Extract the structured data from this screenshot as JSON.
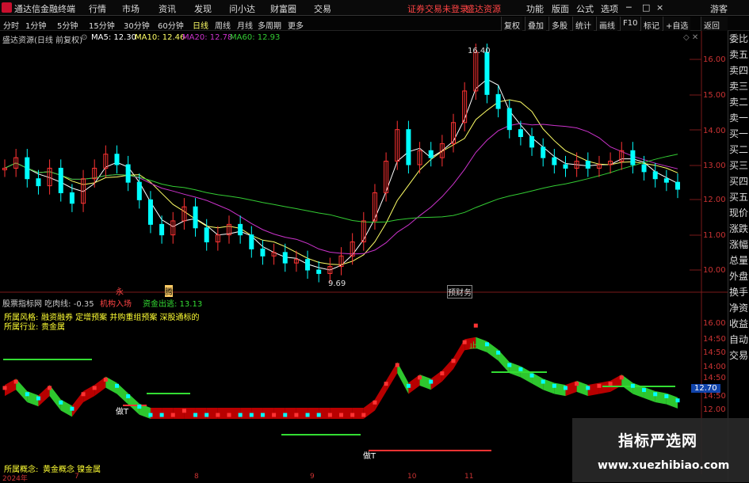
{
  "title_bar": {
    "app_name": "通达信金融终端",
    "menu": [
      "行情",
      "市场",
      "资讯",
      "发现",
      "问小达",
      "财富圈",
      "交易"
    ],
    "login_notice": "证券交易未登录",
    "source": "盛达资源",
    "right_menu": [
      "功能",
      "版面",
      "公式",
      "选项"
    ],
    "user": "游客"
  },
  "period_bar": {
    "periods": [
      "分时",
      "1分钟",
      "5分钟",
      "15分钟",
      "30分钟",
      "60分钟",
      "日线",
      "周线",
      "月线",
      "多周期",
      "更多"
    ],
    "active": "日线",
    "tools": [
      "复权",
      "叠加",
      "多股",
      "统计",
      "画线",
      "F10",
      "标记",
      "+自选",
      "返回"
    ]
  },
  "kline_header": {
    "stock": "盛达资源(日线 前复权)",
    "ma5": "MA5: 12.30",
    "ma10": "MA10: 12.46",
    "ma20": "MA20: 12.78",
    "ma60": "MA60: 12.93"
  },
  "kline_annotations": {
    "high": "16.40",
    "low": "9.69",
    "mark_a": "永",
    "mark_b": "腾",
    "mark_c": "预财务"
  },
  "price_axis": [
    "16.00",
    "15.00",
    "14.00",
    "13.00",
    "12.00",
    "11.00",
    "10.00"
  ],
  "indicator_header": {
    "name": "股票指标网 吃肉线: -0.35",
    "entry": "机构入场",
    "flow": "资金出逃: 13.13"
  },
  "indicator_info": {
    "style_label": "所属风格:",
    "style_value": "融资融券 定增预案 并购重组预案 深股通标的",
    "industry_label": "所属行业:",
    "industry_value": "贵金属",
    "concept_label": "所属概念:",
    "concept_value": "黄金概念 镍金属"
  },
  "indicator_axis": [
    "16.00",
    "14:50",
    "14:50",
    "14:00",
    "14:50",
    "14:50",
    "12.00"
  ],
  "indicator_price_tag": "12.70",
  "indicator_marks": [
    "做T",
    "做T",
    "止"
  ],
  "right_panel": [
    "委比",
    "卖五",
    "卖四",
    "卖三",
    "卖二",
    "卖一",
    "买一",
    "买二",
    "买三",
    "买四",
    "买五",
    "现价",
    "涨跌",
    "涨幅",
    "总量",
    "外盘",
    "换手",
    "净资",
    "收益",
    "自动",
    "交易"
  ],
  "date_axis": [
    "2024年",
    "7",
    "8",
    "9",
    "10",
    "11"
  ],
  "watermark": {
    "title": "指标严选网",
    "url": "www.xuezhibiao.com"
  },
  "colors": {
    "up": "#ff3333",
    "down": "#00ffff",
    "ma5": "#ffffff",
    "ma10": "#ffff66",
    "ma20": "#cc33cc",
    "ma60": "#33cc33",
    "band_green": "#33dd33",
    "band_red": "#cc0000"
  }
}
